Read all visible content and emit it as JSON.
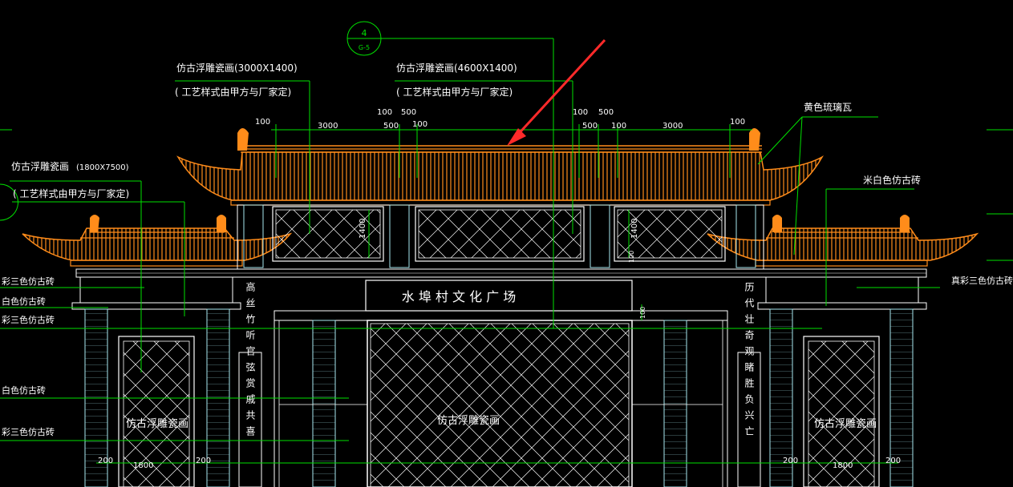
{
  "colors": {
    "background": "#000000",
    "roof": "#ff8c1a",
    "structure": "#ffffff",
    "column": "#a8e8f0",
    "leader": "#00e000",
    "arrow": "#ff2a2a"
  },
  "detail_marker": {
    "top": "4",
    "bottom": "G-5"
  },
  "labels": {
    "panel_top_left": "仿古浮雕瓷画(3000X1400)",
    "panel_top_left_note": "( 工艺样式由甲方与厂家定)",
    "panel_top_center": "仿古浮雕瓷画(4600X1400)",
    "panel_top_center_note": "( 工艺样式由甲方与厂家定)",
    "panel_side": "仿古浮雕瓷画",
    "panel_side_size": "(1800X7500)",
    "panel_side_note": "( 工艺样式由甲方与厂家定)",
    "glazed_tile": "黄色琉璃瓦",
    "offwhite_brick": "米白色仿古砖",
    "true_color_brick_right": "真彩三色仿古砖",
    "left_brick_1": "彩三色仿古砖",
    "left_brick_2": "白色仿古砖",
    "left_brick_3": "彩三色仿古砖",
    "left_brick_4": "白色仿古砖",
    "left_brick_5": "彩三色仿古砖"
  },
  "dimensions": {
    "left": [
      "100",
      "3000",
      "100",
      "500",
      "500",
      "100"
    ],
    "right": [
      "100",
      "500",
      "500",
      "100",
      "3000",
      "100"
    ],
    "panel_height_left": "1400",
    "panel_height_right": "1400",
    "panel_small": "100",
    "gate_small": "100",
    "bottom_left": [
      "200",
      "1800",
      "200"
    ],
    "bottom_right": [
      "200",
      "1800",
      "200"
    ]
  },
  "plaque": "水 埠 村 文 化 广 场",
  "panels": {
    "center_panel": "仿古浮雕瓷画",
    "left_panel": "仿古浮雕瓷画",
    "right_panel": "仿古浮雕瓷画"
  },
  "couplets": {
    "left": "高丝竹听官弦赏戚共喜",
    "right": "历代壮奇观睹胜负兴亡"
  }
}
